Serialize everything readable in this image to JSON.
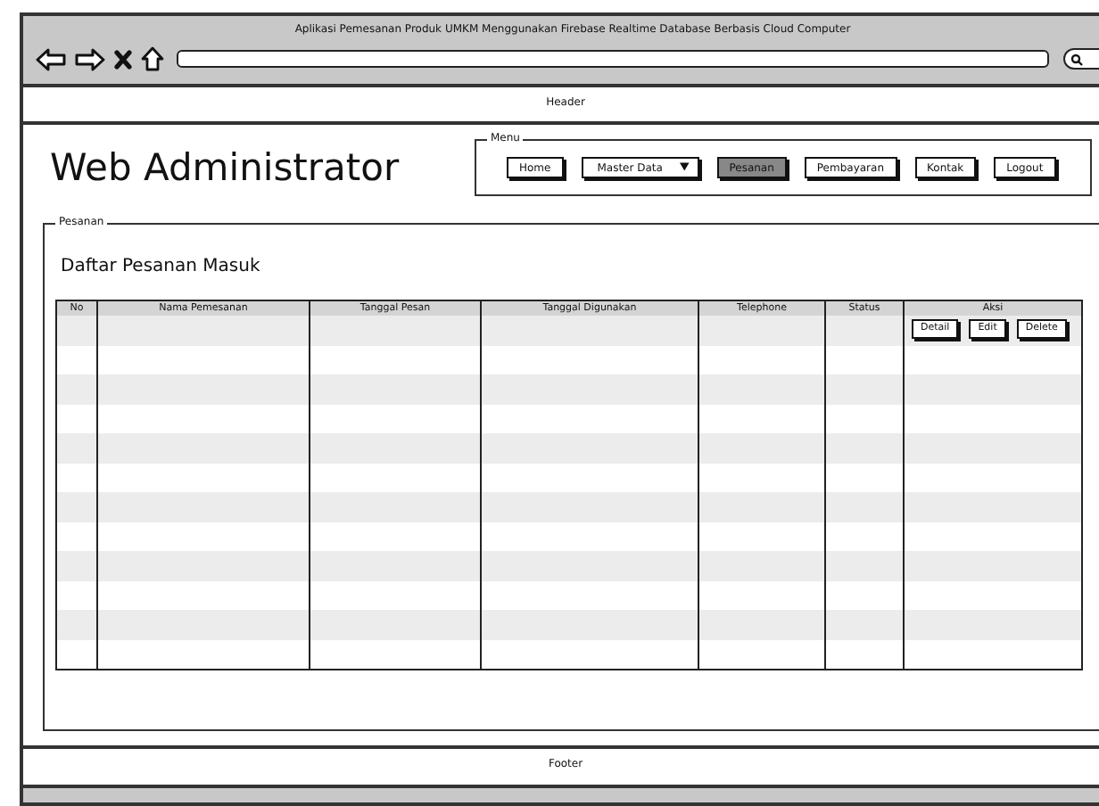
{
  "window": {
    "title": "Aplikasi Pemesanan Produk UMKM Menggunakan Firebase Realtime Database Berbasis Cloud Computer"
  },
  "header": {
    "label": "Header"
  },
  "site_title": "Web Administrator",
  "menu": {
    "legend": "Menu",
    "items": [
      {
        "label": "Home",
        "kind": "button",
        "selected": false
      },
      {
        "label": "Master Data",
        "kind": "dropdown",
        "selected": false
      },
      {
        "label": "Pesanan",
        "kind": "button",
        "selected": true
      },
      {
        "label": "Pembayaran",
        "kind": "button",
        "selected": false
      },
      {
        "label": "Kontak",
        "kind": "button",
        "selected": false
      },
      {
        "label": "Logout",
        "kind": "button",
        "selected": false
      }
    ]
  },
  "section": {
    "legend": "Pesanan",
    "heading": "Daftar Pesanan Masuk"
  },
  "table": {
    "columns": [
      "No",
      "Nama Pemesanan",
      "Tanggal Pesan",
      "Tanggal Digunakan",
      "Telephone",
      "Status",
      "Aksi"
    ],
    "actions": [
      "Detail",
      "Edit",
      "Delete"
    ]
  },
  "footer": {
    "label": "Footer"
  }
}
